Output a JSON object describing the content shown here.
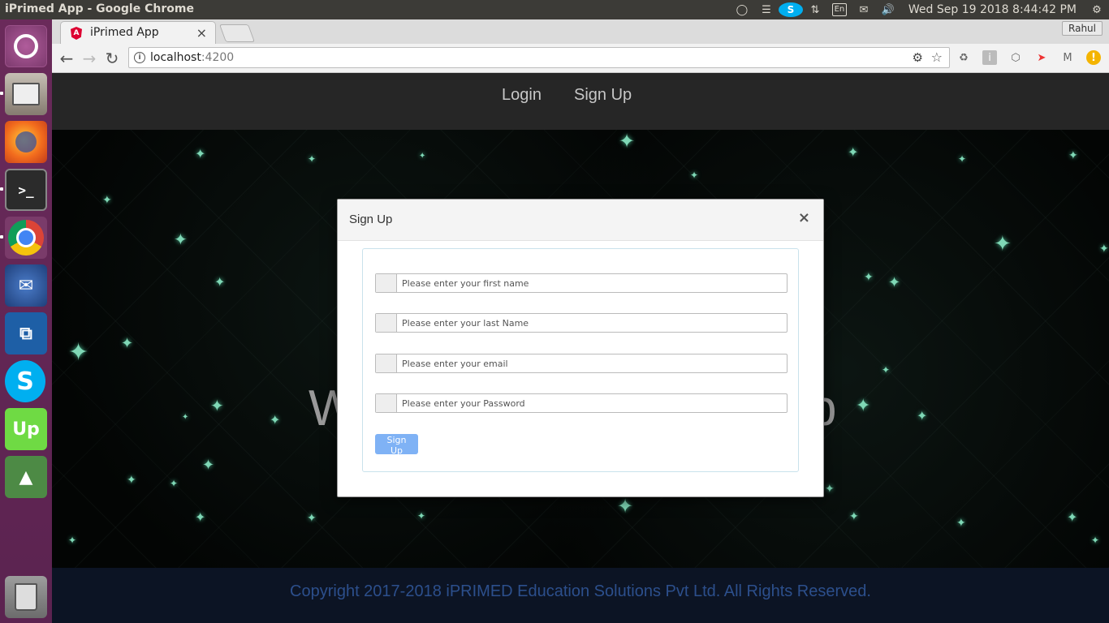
{
  "system": {
    "window_title": "iPrimed App - Google Chrome",
    "keyboard_layout": "En",
    "clock": "Wed Sep 19 2018  8:44:42 PM",
    "skype_letter": "S"
  },
  "launcher": {
    "apps": [
      {
        "name": "ubuntu-dash"
      },
      {
        "name": "files"
      },
      {
        "name": "firefox"
      },
      {
        "name": "terminal"
      },
      {
        "name": "chrome"
      },
      {
        "name": "thunderbird"
      },
      {
        "name": "vscode"
      },
      {
        "name": "skype",
        "label": "S"
      },
      {
        "name": "upwork",
        "label": "Up"
      },
      {
        "name": "rocket"
      },
      {
        "name": "trash"
      }
    ]
  },
  "browser": {
    "tab_title": "iPrimed App",
    "tab_close": "×",
    "profile_name": "Rahul",
    "url_host": "localhost",
    "url_port": ":4200",
    "info_icon": "i"
  },
  "navbar": {
    "login": "Login",
    "signup": "Sign Up"
  },
  "hero": {
    "title_left": "W",
    "title_right": "p"
  },
  "modal": {
    "title": "Sign Up",
    "close": "×",
    "fields": {
      "first_name": {
        "placeholder": "Please enter your first name"
      },
      "last_name": {
        "placeholder": "Please enter your last Name"
      },
      "email": {
        "placeholder": "Please enter your email"
      },
      "password": {
        "placeholder": "Please enter your Password"
      }
    },
    "submit_label": "Sign Up"
  },
  "footer": {
    "copyright": "Copyright 2017-2018 iPRIMED Education Solutions Pvt Ltd. All Rights Reserved."
  },
  "colors": {
    "launcher_bg": "#5e2750",
    "navbar_bg": "#262626",
    "footer_bg": "#0c1424",
    "footer_text": "#2c4f8c",
    "submit_button": "#7fb2f5",
    "star": "#7fd8b6"
  }
}
